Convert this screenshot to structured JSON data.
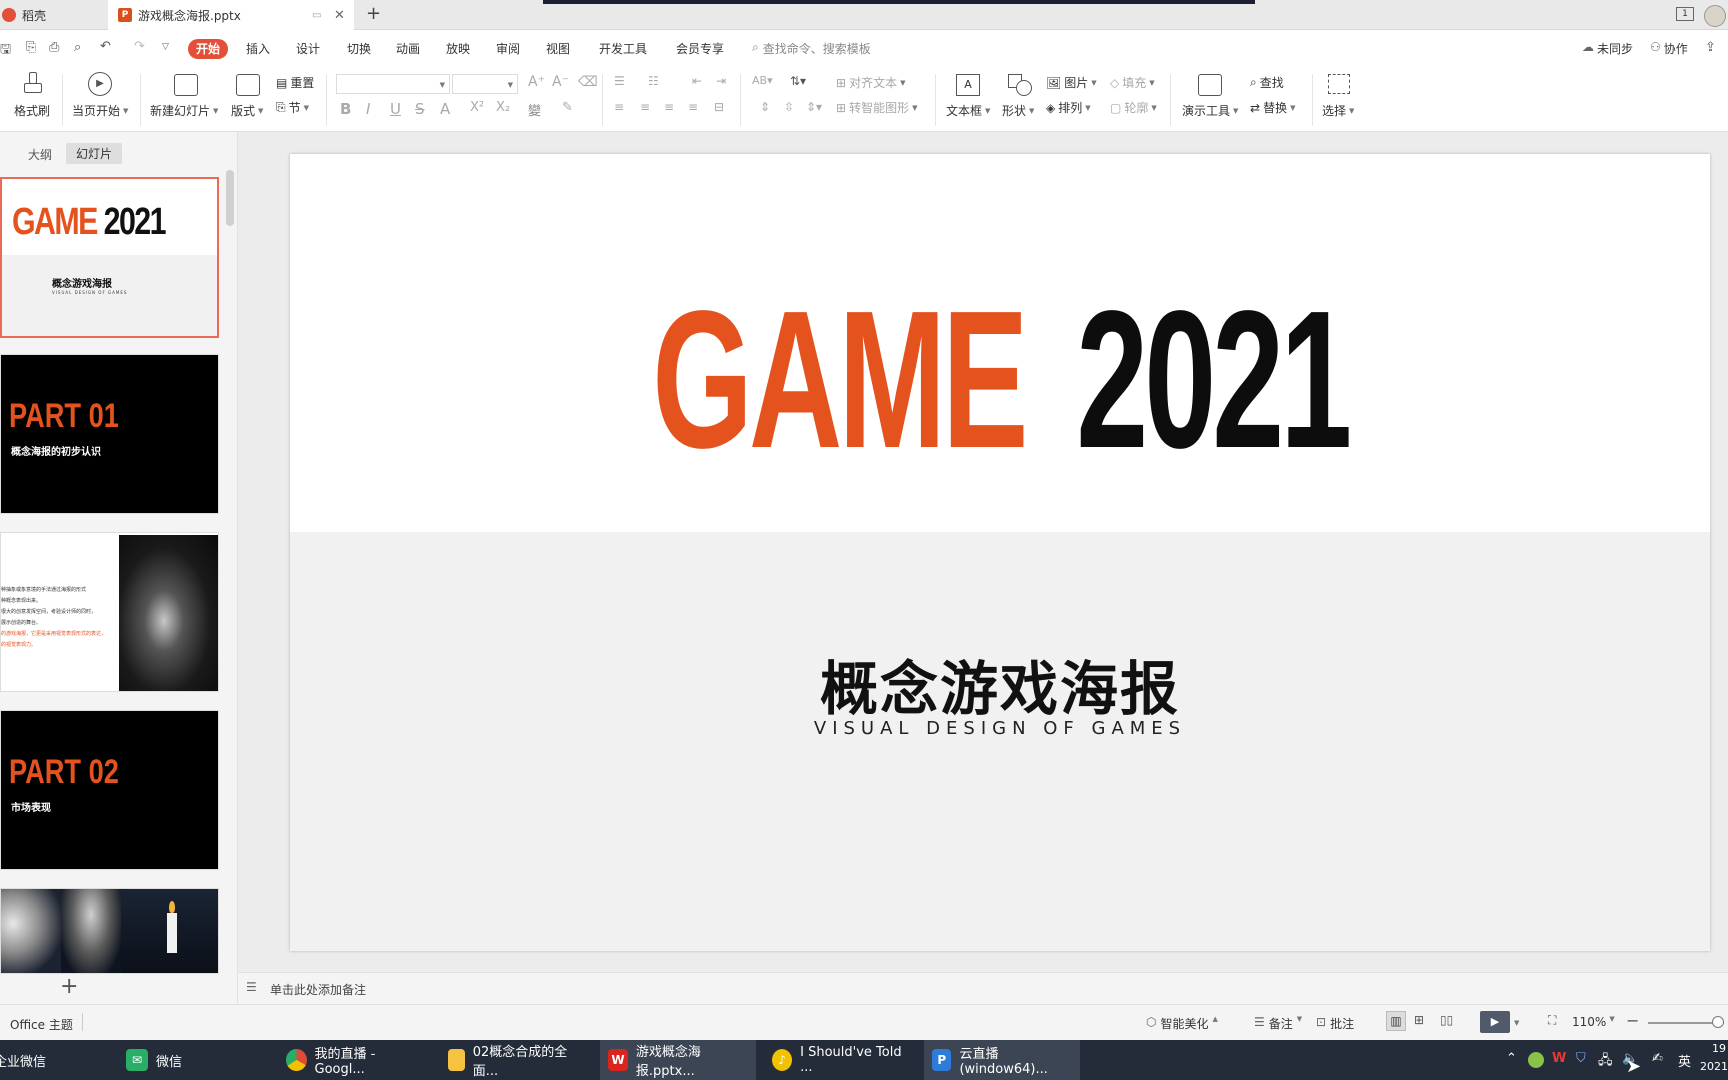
{
  "titlebar": {
    "tabs": [
      {
        "label": "稻壳",
        "active": false
      },
      {
        "label": "游戏概念海报.pptx",
        "active": true
      }
    ],
    "new_tab": "+",
    "window_number": "1"
  },
  "menu": {
    "items": [
      "开始",
      "插入",
      "设计",
      "切换",
      "动画",
      "放映",
      "审阅",
      "视图",
      "开发工具",
      "会员专享"
    ],
    "search_placeholder": "查找命令、搜索模板",
    "sync": "未同步",
    "collab": "协作"
  },
  "ribbon": {
    "format_painter": "格式刷",
    "from_current": "当页开始",
    "new_slide": "新建幻灯片",
    "layout": "版式",
    "reset": "重置",
    "section": "节",
    "align_text": "对齐文本",
    "smart_art": "转智能图形",
    "textbox": "文本框",
    "shape": "形状",
    "picture": "图片",
    "arrange": "排列",
    "fill": "填充",
    "outline": "轮廓",
    "presenter_tools": "演示工具",
    "find": "查找",
    "replace": "替换",
    "select": "选择"
  },
  "left_panel": {
    "tabs": [
      "大纲",
      "幻灯片"
    ],
    "add": "+",
    "thumbs": [
      {
        "title_a": "GAME",
        "title_b": "2021",
        "subtitle": "概念游戏海报",
        "sub_en": "VISUAL DESIGN OF GAMES"
      },
      {
        "title": "PART 01",
        "subtitle": "概念海报的初步认识"
      },
      {
        "lines": [
          "种抽象或象意境的手法通过海报的形式",
          "种概念表现出来。",
          "很大的创意发挥空间，考验设计师的同时，",
          "展示创造的舞台。",
          "的游戏海报，它更是采用视觉表现形式的表达，",
          "的视觉表现力。"
        ]
      },
      {
        "title": "PART 02",
        "subtitle": "市场表现"
      }
    ]
  },
  "slide": {
    "title_orange": "GAME",
    "title_black": "2021",
    "subtitle_cn": "概念游戏海报",
    "subtitle_en": "VISUAL DESIGN OF GAMES"
  },
  "notes": {
    "placeholder": "单击此处添加备注"
  },
  "status": {
    "theme": "Office 主题",
    "beautify": "智能美化",
    "notes": "备注",
    "comments": "批注",
    "zoom": "110%"
  },
  "taskbar": {
    "items": [
      {
        "label": "企业微信",
        "color": "#3a8fd9"
      },
      {
        "label": "微信",
        "color": "#2aae67"
      },
      {
        "label": "我的直播 - Googl...",
        "color": "#dd4b39"
      },
      {
        "label": "02概念合成的全面...",
        "color": "#f5c242"
      },
      {
        "label": "游戏概念海报.pptx...",
        "color": "#d9251d"
      },
      {
        "label": "I Should've Told ...",
        "color": "#f2c200"
      },
      {
        "label": "云直播(window64)...",
        "color": "#2f7bd8"
      }
    ],
    "ime": "英",
    "time": "19",
    "date": "2021"
  },
  "colors": {
    "accent": "#e2503a",
    "orange": "#e4531e",
    "taskbar": "#232c38"
  }
}
